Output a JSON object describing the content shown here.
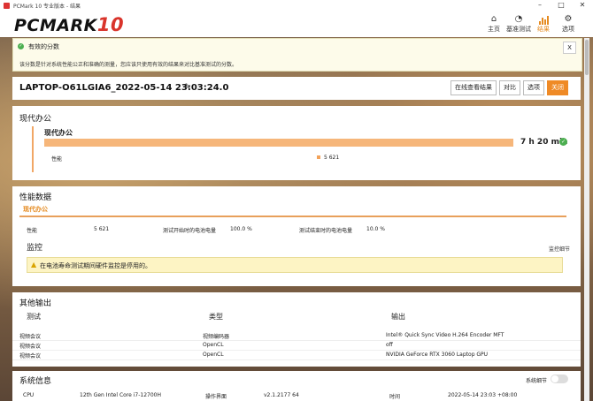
{
  "window": {
    "title": "PCMark 10 专业版本 - 结果"
  },
  "logo": {
    "text": "PCMARK",
    "version": "10"
  },
  "nav": [
    {
      "label": "主页",
      "icon": "home-icon"
    },
    {
      "label": "基准测试",
      "icon": "gauge-icon"
    },
    {
      "label": "结果",
      "icon": "bar-chart-icon",
      "active": true
    },
    {
      "label": "选项",
      "icon": "gear-icon"
    }
  ],
  "notice": {
    "title": "有效的分数",
    "desc": "该分数是针对系统性能公正和准确的测量，您应该只使用有效的结果来对比基准测试的分数。",
    "close": "X"
  },
  "result": {
    "name": "LAPTOP-O61LGIA6_2022-05-14 23:03:24.0",
    "buttons": [
      "在线查看结果",
      "对比",
      "选项",
      "关闭"
    ]
  },
  "section_office": {
    "title": "现代办公",
    "item_name": "现代办公",
    "time": "7 h 20 min",
    "perf_label": "性能",
    "perf_value": "5 621"
  },
  "perf_data": {
    "title": "性能数据",
    "tab": "现代办公",
    "rows": [
      {
        "k": "性能",
        "v": "5 621"
      },
      {
        "k": "测试开始时的电池电量",
        "v": "100.0 %"
      },
      {
        "k": "测试结束时的电池电量",
        "v": "10.0 %"
      }
    ],
    "monitor_title": "监控",
    "monitor_link": "监控细节",
    "warning": "在电池寿命测试期间硬件监控是停用的。"
  },
  "other_output": {
    "title": "其他输出",
    "headers": [
      "测试",
      "类型",
      "输出"
    ],
    "rows": [
      [
        "视频会议",
        "视频编码器",
        "Intel® Quick Sync Video H.264 Encoder MFT"
      ],
      [
        "视频会议",
        "OpenCL",
        "off"
      ],
      [
        "视频会议",
        "OpenCL",
        "NVIDIA GeForce RTX 3060 Laptop GPU"
      ]
    ]
  },
  "sysinfo": {
    "title": "系统信息",
    "toggle_label": "系统细节",
    "cpu_label": "CPU",
    "cpu_value": "12th Gen Intel Core i7-12700H",
    "os_label": "操作界面",
    "os_value": "v2.1.2177 64",
    "time_label": "时间",
    "time_value": "2022-05-14 23:03 +08:00"
  }
}
